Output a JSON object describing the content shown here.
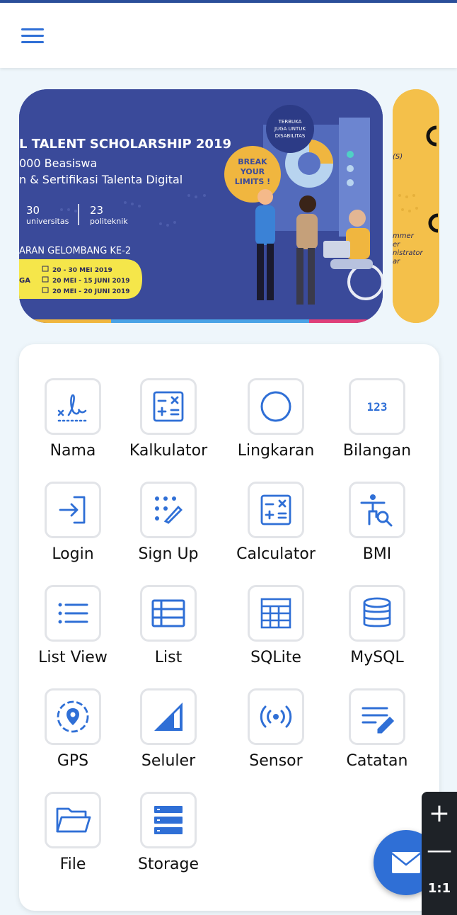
{
  "banner": {
    "title": "L TALENT SCHOLARSHIP 2019",
    "line1": "000 Beasiswa",
    "line2": "n & Sertifikasi Talenta Digital",
    "stat1_num": "30",
    "stat1_label": "universitas",
    "stat2_num": "23",
    "stat2_label": "politeknik",
    "wave": "ARAN GELOMBANG KE-2",
    "dates": [
      "20 - 30 MEI 2019",
      "20 MEI - 15 JUNI 2019",
      "20 MEI - 20 JUNI 2019"
    ],
    "dates_prefix": "GA",
    "badge_break": "BREAK YOUR LIMITS !",
    "badge_open": "TERBUKA JUGA UNTUK DISABILITAS"
  },
  "banner2": {
    "text": [
      "(S)",
      "mmer",
      "er",
      "nistrator",
      "ar"
    ]
  },
  "menu": {
    "items": [
      {
        "label": "Nama",
        "icon": "signature-icon"
      },
      {
        "label": "Kalkulator",
        "icon": "calculator-icon"
      },
      {
        "label": "Lingkaran",
        "icon": "circle-icon"
      },
      {
        "label": "Bilangan",
        "icon": "numbers-icon"
      },
      {
        "label": "Login",
        "icon": "login-icon"
      },
      {
        "label": "Sign Up",
        "icon": "signup-icon"
      },
      {
        "label": "Calculator",
        "icon": "calculator-icon"
      },
      {
        "label": "BMI",
        "icon": "body-search-icon"
      },
      {
        "label": "List View",
        "icon": "list-icon"
      },
      {
        "label": "List",
        "icon": "table-list-icon"
      },
      {
        "label": "SQLite",
        "icon": "grid-table-icon"
      },
      {
        "label": "MySQL",
        "icon": "database-icon"
      },
      {
        "label": "GPS",
        "icon": "location-icon"
      },
      {
        "label": "Seluler",
        "icon": "signal-icon"
      },
      {
        "label": "Sensor",
        "icon": "sensor-icon"
      },
      {
        "label": "Catatan",
        "icon": "notes-icon"
      },
      {
        "label": "File",
        "icon": "folder-icon"
      },
      {
        "label": "Storage",
        "icon": "storage-icon"
      }
    ]
  },
  "zoom": {
    "plus": "+",
    "minus": "—",
    "reset": "1:1"
  },
  "colors": {
    "accent": "#2f6fd6",
    "banner_bg": "#3a4a9a",
    "banner_yellow": "#f4c04a"
  }
}
